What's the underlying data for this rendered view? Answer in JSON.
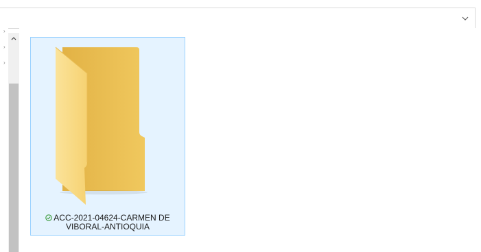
{
  "address_bar": {
    "dropdown_icon": "chevron-down-icon"
  },
  "navigation_pane": {
    "scroll_up_icon": "chevron-up-icon",
    "collapsed_chevrons": [
      "›",
      "›",
      "›"
    ]
  },
  "files": [
    {
      "name_line_1": "ACC-2021-04624-CARMEN DE",
      "name_line_2": "VIBORAL-ANTIOQUIA",
      "type": "folder",
      "status_icon": "sync-ok-check-icon",
      "selected": true
    }
  ],
  "colors": {
    "selection_fill": "#e5f3ff",
    "selection_border": "#99d1ff",
    "folder_front": "#f8d775",
    "folder_back": "#e8b94a",
    "sync_green": "#3a9a3a",
    "scrollbar_thumb": "#c2c2c2"
  }
}
